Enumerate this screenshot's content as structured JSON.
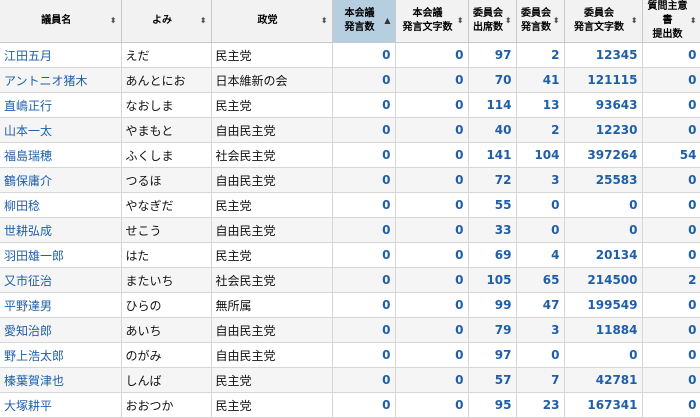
{
  "headers": [
    {
      "line1": "議員名",
      "line2": ""
    },
    {
      "line1": "よみ",
      "line2": ""
    },
    {
      "line1": "政党",
      "line2": ""
    },
    {
      "line1": "本会議",
      "line2": "発言数"
    },
    {
      "line1": "本会議",
      "line2": "発言文字数"
    },
    {
      "line1": "委員会",
      "line2": "出席数"
    },
    {
      "line1": "委員会",
      "line2": "発言数"
    },
    {
      "line1": "委員会",
      "line2": "発言文字数"
    },
    {
      "line1": "質問主意書",
      "line2": "提出数"
    }
  ],
  "sort_icons": {
    "unsorted": "⬍",
    "ascending": "▲"
  },
  "rows": [
    {
      "name": "江田五月",
      "yomi": "えだ",
      "party": "民主党",
      "plenary_speeches": "0",
      "plenary_chars": "0",
      "committee_attend": "97",
      "committee_speeches": "2",
      "committee_chars": "12345",
      "questions": "0"
    },
    {
      "name": "アントニオ猪木",
      "yomi": "あんとにお",
      "party": "日本維新の会",
      "plenary_speeches": "0",
      "plenary_chars": "0",
      "committee_attend": "70",
      "committee_speeches": "41",
      "committee_chars": "121115",
      "questions": "0"
    },
    {
      "name": "直嶋正行",
      "yomi": "なおしま",
      "party": "民主党",
      "plenary_speeches": "0",
      "plenary_chars": "0",
      "committee_attend": "114",
      "committee_speeches": "13",
      "committee_chars": "93643",
      "questions": "0"
    },
    {
      "name": "山本一太",
      "yomi": "やまもと",
      "party": "自由民主党",
      "plenary_speeches": "0",
      "plenary_chars": "0",
      "committee_attend": "40",
      "committee_speeches": "2",
      "committee_chars": "12230",
      "questions": "0"
    },
    {
      "name": "福島瑞穂",
      "yomi": "ふくしま",
      "party": "社会民主党",
      "plenary_speeches": "0",
      "plenary_chars": "0",
      "committee_attend": "141",
      "committee_speeches": "104",
      "committee_chars": "397264",
      "questions": "54"
    },
    {
      "name": "鶴保庸介",
      "yomi": "つるほ",
      "party": "自由民主党",
      "plenary_speeches": "0",
      "plenary_chars": "0",
      "committee_attend": "72",
      "committee_speeches": "3",
      "committee_chars": "25583",
      "questions": "0"
    },
    {
      "name": "柳田稔",
      "yomi": "やなぎだ",
      "party": "民主党",
      "plenary_speeches": "0",
      "plenary_chars": "0",
      "committee_attend": "55",
      "committee_speeches": "0",
      "committee_chars": "0",
      "questions": "0"
    },
    {
      "name": "世耕弘成",
      "yomi": "せこう",
      "party": "自由民主党",
      "plenary_speeches": "0",
      "plenary_chars": "0",
      "committee_attend": "33",
      "committee_speeches": "0",
      "committee_chars": "0",
      "questions": "0"
    },
    {
      "name": "羽田雄一郎",
      "yomi": "はた",
      "party": "民主党",
      "plenary_speeches": "0",
      "plenary_chars": "0",
      "committee_attend": "69",
      "committee_speeches": "4",
      "committee_chars": "20134",
      "questions": "0"
    },
    {
      "name": "又市征治",
      "yomi": "またいち",
      "party": "社会民主党",
      "plenary_speeches": "0",
      "plenary_chars": "0",
      "committee_attend": "105",
      "committee_speeches": "65",
      "committee_chars": "214500",
      "questions": "2"
    },
    {
      "name": "平野達男",
      "yomi": "ひらの",
      "party": "無所属",
      "plenary_speeches": "0",
      "plenary_chars": "0",
      "committee_attend": "99",
      "committee_speeches": "47",
      "committee_chars": "199549",
      "questions": "0"
    },
    {
      "name": "愛知治郎",
      "yomi": "あいち",
      "party": "自由民主党",
      "plenary_speeches": "0",
      "plenary_chars": "0",
      "committee_attend": "79",
      "committee_speeches": "3",
      "committee_chars": "11884",
      "questions": "0"
    },
    {
      "name": "野上浩太郎",
      "yomi": "のがみ",
      "party": "自由民主党",
      "plenary_speeches": "0",
      "plenary_chars": "0",
      "committee_attend": "97",
      "committee_speeches": "0",
      "committee_chars": "0",
      "questions": "0"
    },
    {
      "name": "榛葉賀津也",
      "yomi": "しんば",
      "party": "民主党",
      "plenary_speeches": "0",
      "plenary_chars": "0",
      "committee_attend": "57",
      "committee_speeches": "7",
      "committee_chars": "42781",
      "questions": "0"
    },
    {
      "name": "大塚耕平",
      "yomi": "おおつか",
      "party": "民主党",
      "plenary_speeches": "0",
      "plenary_chars": "0",
      "committee_attend": "95",
      "committee_speeches": "23",
      "committee_chars": "167341",
      "questions": "0"
    }
  ]
}
